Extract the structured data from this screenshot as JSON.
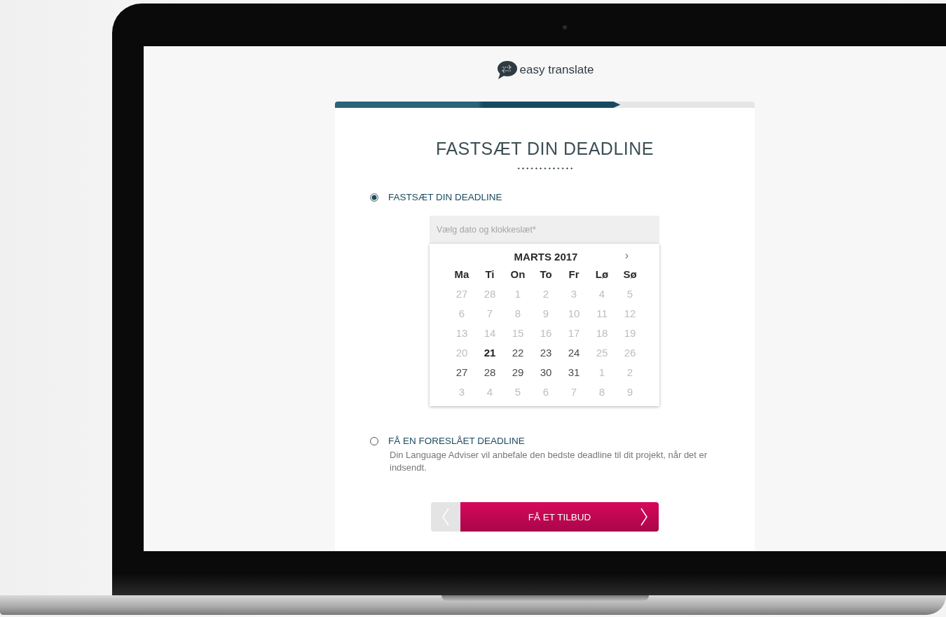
{
  "logo": {
    "text": "easy translate"
  },
  "progress": {
    "level": 0.68
  },
  "title": "FASTSÆT DIN DEADLINE",
  "options": [
    {
      "label": "FASTSÆT DIN DEADLINE",
      "selected": true,
      "kind": "date"
    },
    {
      "label": "FÅ EN FORESLÅET DEADLINE",
      "selected": false,
      "kind": "text",
      "description": "Din Language Adviser vil anbefale den bedste deadline til dit projekt, når det er indsendt."
    }
  ],
  "date_field": {
    "placeholder": "Vælg dato og klokkeslæt*"
  },
  "calendar": {
    "month": "MARTS 2017",
    "next": "›",
    "weekdays": [
      "Ma",
      "Ti",
      "On",
      "To",
      "Fr",
      "Lø",
      "Sø"
    ],
    "days": [
      {
        "label": "27",
        "kind": "muted"
      },
      {
        "label": "28",
        "kind": "muted"
      },
      {
        "label": "1",
        "kind": "muted"
      },
      {
        "label": "2",
        "kind": "muted"
      },
      {
        "label": "3",
        "kind": "muted"
      },
      {
        "label": "4",
        "kind": "muted"
      },
      {
        "label": "5",
        "kind": "muted"
      },
      {
        "label": "6",
        "kind": "muted"
      },
      {
        "label": "7",
        "kind": "muted"
      },
      {
        "label": "8",
        "kind": "muted"
      },
      {
        "label": "9",
        "kind": "muted"
      },
      {
        "label": "10",
        "kind": "muted"
      },
      {
        "label": "11",
        "kind": "muted"
      },
      {
        "label": "12",
        "kind": "muted"
      },
      {
        "label": "13",
        "kind": "muted"
      },
      {
        "label": "14",
        "kind": "muted"
      },
      {
        "label": "15",
        "kind": "muted"
      },
      {
        "label": "16",
        "kind": "muted"
      },
      {
        "label": "17",
        "kind": "muted"
      },
      {
        "label": "18",
        "kind": "muted"
      },
      {
        "label": "19",
        "kind": "muted"
      },
      {
        "label": "20",
        "kind": "muted"
      },
      {
        "label": "21",
        "kind": "today"
      },
      {
        "label": "22",
        "kind": "active"
      },
      {
        "label": "23",
        "kind": "active"
      },
      {
        "label": "24",
        "kind": "active"
      },
      {
        "label": "25",
        "kind": "muted"
      },
      {
        "label": "26",
        "kind": "muted"
      },
      {
        "label": "27",
        "kind": "active"
      },
      {
        "label": "28",
        "kind": "active"
      },
      {
        "label": "29",
        "kind": "active"
      },
      {
        "label": "30",
        "kind": "active"
      },
      {
        "label": "31",
        "kind": "active"
      },
      {
        "label": "1",
        "kind": "muted"
      },
      {
        "label": "2",
        "kind": "muted"
      },
      {
        "label": "3",
        "kind": "muted"
      },
      {
        "label": "4",
        "kind": "muted"
      },
      {
        "label": "5",
        "kind": "muted"
      },
      {
        "label": "6",
        "kind": "muted"
      },
      {
        "label": "7",
        "kind": "muted"
      },
      {
        "label": "8",
        "kind": "muted"
      },
      {
        "label": "9",
        "kind": "muted"
      }
    ]
  },
  "buttons": {
    "submit": "FÅ ET TILBUD"
  }
}
